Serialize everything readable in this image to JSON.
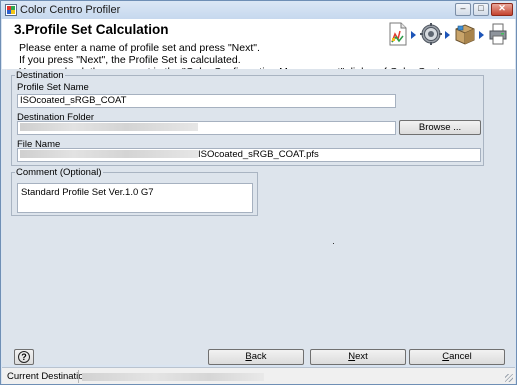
{
  "window": {
    "title": "Color Centro Profiler",
    "minimize_glyph": "–",
    "maximize_glyph": "□",
    "close_glyph": "✕"
  },
  "header": {
    "step_title": "3.Profile Set Calculation",
    "instructions": [
      "Please enter a name of profile set and press \"Next\".",
      "If you press \"Next\", the Profile Set is calculated.",
      "You can check the comment in the \"Color Configuration Management\" dialog of Color Centro."
    ],
    "wizard_icons": [
      "document-chart-icon",
      "gear-icon",
      "box-icon",
      "printer-icon"
    ]
  },
  "destination": {
    "group_label": "Destination",
    "profile_set_name_label": "Profile Set Name",
    "profile_set_name_value": "ISOcoated_sRGB_COAT",
    "destination_folder_label": "Destination Folder",
    "browse_label": "Browse ...",
    "file_name_label": "File Name",
    "file_name_value": "ISOcoated_sRGB_COAT.pfs"
  },
  "comment": {
    "group_label": "Comment (Optional)",
    "value": "Standard Profile Set Ver.1.0 G7"
  },
  "footer": {
    "help_glyph": "?",
    "back_label": "Back",
    "back_hotkey": "B",
    "back_rest": "ack",
    "next_label": "Next",
    "next_hotkey": "N",
    "next_rest": "ext",
    "cancel_label": "Cancel",
    "cancel_hotkey": "C",
    "cancel_rest": "ancel"
  },
  "status": {
    "label": "Current Destination"
  },
  "colors": {
    "window_bg": "#d9e4f1",
    "content_bg": "#dde4ec",
    "accent_arrow": "#1d55b8"
  }
}
